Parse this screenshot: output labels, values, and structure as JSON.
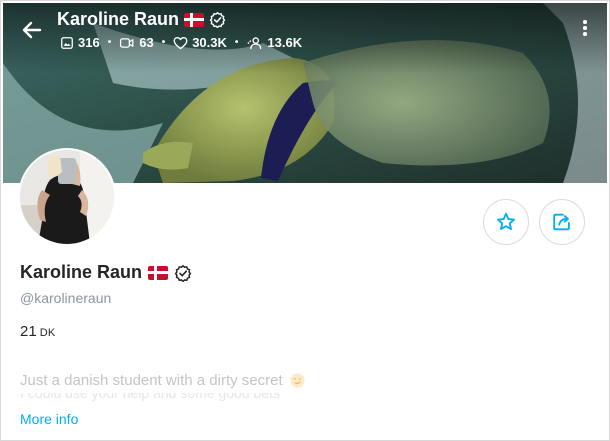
{
  "header": {
    "name": "Karoline Raun",
    "flag": "denmark-flag",
    "stats": {
      "photos": "316",
      "videos": "63",
      "likes": "30.3K",
      "fans": "13.6K"
    }
  },
  "profile": {
    "name": "Karoline Raun",
    "handle": "@karolineraun",
    "location_value": "21",
    "location_code": "DK",
    "bio_line1": "Just a danish student with a dirty secret",
    "bio_line2": "I could use your help and some good bets",
    "more_info": "More info"
  },
  "colors": {
    "accent": "#00aff0",
    "flag_red": "#c8102e"
  }
}
